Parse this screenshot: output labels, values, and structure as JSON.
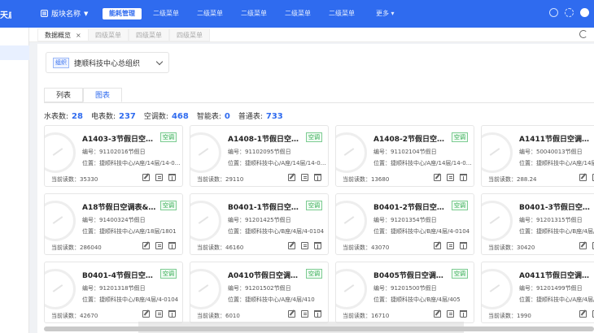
{
  "topbar": {
    "logo_text": "天启",
    "module_label": "版块名称",
    "menus": [
      {
        "label": "能耗管理",
        "active": true
      },
      {
        "label": "二级菜单",
        "active": false
      },
      {
        "label": "二级菜单",
        "active": false
      },
      {
        "label": "二级菜单",
        "active": false
      },
      {
        "label": "二级菜单",
        "active": false
      },
      {
        "label": "二级菜单",
        "active": false
      }
    ],
    "more_label": "更多",
    "icons": [
      "notification-icon",
      "settings-icon",
      "avatar"
    ]
  },
  "tabs": [
    {
      "label": "数据概览",
      "active": true,
      "close": "×"
    },
    {
      "label": "四级菜单",
      "active": false
    },
    {
      "label": "四级菜单",
      "active": false
    },
    {
      "label": "四级菜单",
      "active": false
    }
  ],
  "org_select": {
    "badge": "组织",
    "value": "捷顺科技中心总组织"
  },
  "view_tabs": [
    {
      "label": "列表",
      "active": false
    },
    {
      "label": "图表",
      "active": true
    }
  ],
  "stats": [
    {
      "label": "水表数:",
      "value": "28"
    },
    {
      "label": "电表数:",
      "value": "237"
    },
    {
      "label": "空调数:",
      "value": "468"
    },
    {
      "label": "智能表:",
      "value": "0"
    },
    {
      "label": "普通表:",
      "value": "733"
    }
  ],
  "cards": [
    {
      "title": "A1403-3节假日空调...",
      "tag": "空调",
      "code": "编号：91102016节假日",
      "loc": "位置：捷顺科技中心/A座/14层/14-03...",
      "reading": "当前读数：35330"
    },
    {
      "title": "A1408-1节假日空调表...",
      "tag": "空调",
      "code": "编号：91102095节假日",
      "loc": "位置：捷顺科技中心/A座/14层/14-08...",
      "reading": "当前读数：29110"
    },
    {
      "title": "A1408-2节假日空调...",
      "tag": "空调",
      "code": "编号：91102104节假日",
      "loc": "位置：捷顺科技中心/A座/14层/14-08...",
      "reading": "当前读数：13680"
    },
    {
      "title": "A1411节假日空调表&_...",
      "tag": "空调",
      "code": "编号：50040013节假日",
      "loc": "位置：捷顺科技中心/A座/14层/14-...",
      "reading": "当前读数：288.24"
    },
    {
      "title": "A18节假日空调表&_91...",
      "tag": "空调",
      "code": "编号：91400324节假日",
      "loc": "位置：捷顺科技中心/A座/18层/1801",
      "reading": "当前读数：286040"
    },
    {
      "title": "B0401-1节假日空调...",
      "tag": "空调",
      "code": "编号：91201425节假日",
      "loc": "位置：捷顺科技中心/B座/4层/4-0104",
      "reading": "当前读数：46160"
    },
    {
      "title": "B0401-2节假日空调...",
      "tag": "空调",
      "code": "编号：91201354节假日",
      "loc": "位置：捷顺科技中心/B座/4层/4-0104",
      "reading": "当前读数：43070"
    },
    {
      "title": "B0401-3节假日空调...",
      "tag": "空调",
      "code": "编号：91201315节假日",
      "loc": "位置：捷顺科技中心/B座/4层/4-...",
      "reading": "当前读数：30420"
    },
    {
      "title": "B0401-4节假日空调...",
      "tag": "空调",
      "code": "编号：91201318节假日",
      "loc": "位置：捷顺科技中心/B座/4层/4-0104",
      "reading": "当前读数：42670"
    },
    {
      "title": "A0410节假日空调表...",
      "tag": "空调",
      "code": "编号：91201502节假日",
      "loc": "位置：捷顺科技中心/A座/4层/410",
      "reading": "当前读数：6010"
    },
    {
      "title": "B0405节假日空调表&...",
      "tag": "空调",
      "code": "编号：91201500节假日",
      "loc": "位置：捷顺科技中心/B座/4层/405",
      "reading": "当前读数：16710"
    },
    {
      "title": "A0411节假日空调表...",
      "tag": "空调",
      "code": "编号：91201499节假日",
      "loc": "位置：捷顺科技中心/A座/4层/4...",
      "reading": "当前读数：1990"
    }
  ]
}
